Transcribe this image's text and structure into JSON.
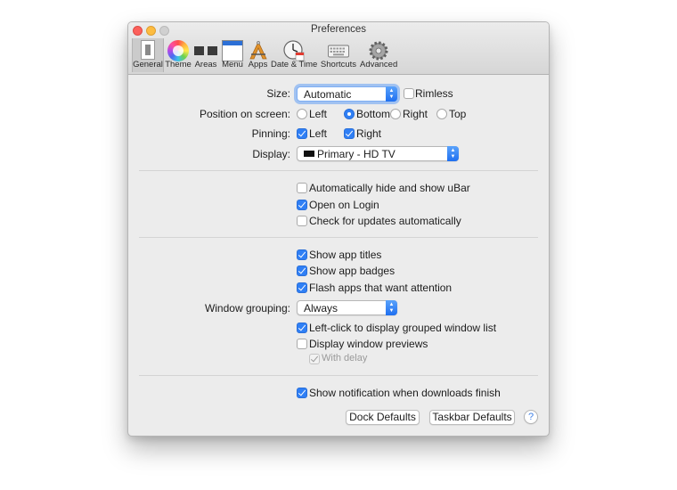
{
  "window": {
    "title": "Preferences"
  },
  "toolbar": {
    "items": [
      {
        "label": "General",
        "icon": "general-switch-icon",
        "selected": true
      },
      {
        "label": "Theme",
        "icon": "color-wheel-icon"
      },
      {
        "label": "Areas",
        "icon": "areas-icon"
      },
      {
        "label": "Menu",
        "icon": "menu-window-icon"
      },
      {
        "label": "Apps",
        "icon": "apps-compass-icon"
      },
      {
        "label": "Date & Time",
        "icon": "clock-calendar-icon"
      },
      {
        "label": "Shortcuts",
        "icon": "keyboard-icon"
      },
      {
        "label": "Advanced",
        "icon": "gear-icon"
      }
    ]
  },
  "general": {
    "size": {
      "label": "Size:",
      "value": "Automatic",
      "rimless_label": "Rimless",
      "rimless_checked": false
    },
    "position": {
      "label": "Position on screen:",
      "options": [
        "Left",
        "Bottom",
        "Right",
        "Top"
      ],
      "selected": "Bottom"
    },
    "pinning": {
      "label": "Pinning:",
      "left_label": "Left",
      "left_checked": true,
      "right_label": "Right",
      "right_checked": true
    },
    "display": {
      "label": "Display:",
      "value": "Primary - HD TV"
    },
    "startup": [
      {
        "label": "Automatically hide and show uBar",
        "checked": false
      },
      {
        "label": "Open on Login",
        "checked": true
      },
      {
        "label": "Check for updates automatically",
        "checked": false
      }
    ],
    "apps": [
      {
        "label": "Show app titles",
        "checked": true
      },
      {
        "label": "Show app badges",
        "checked": true
      },
      {
        "label": "Flash apps that want attention",
        "checked": true
      }
    ],
    "window_grouping": {
      "label": "Window grouping:",
      "value": "Always"
    },
    "grouping_options": [
      {
        "label": "Left-click to display grouped window list",
        "checked": true
      },
      {
        "label": "Display window previews",
        "checked": false
      }
    ],
    "with_delay": {
      "label": "With delay",
      "checked": true,
      "disabled": true
    },
    "downloads": {
      "label": "Show notification when downloads finish",
      "checked": true
    }
  },
  "buttons": {
    "dock_defaults": "Dock Defaults",
    "taskbar_defaults": "Taskbar Defaults",
    "help": "?"
  },
  "colors": {
    "accent": "#2f7ff5",
    "window_bg": "#ececec"
  }
}
